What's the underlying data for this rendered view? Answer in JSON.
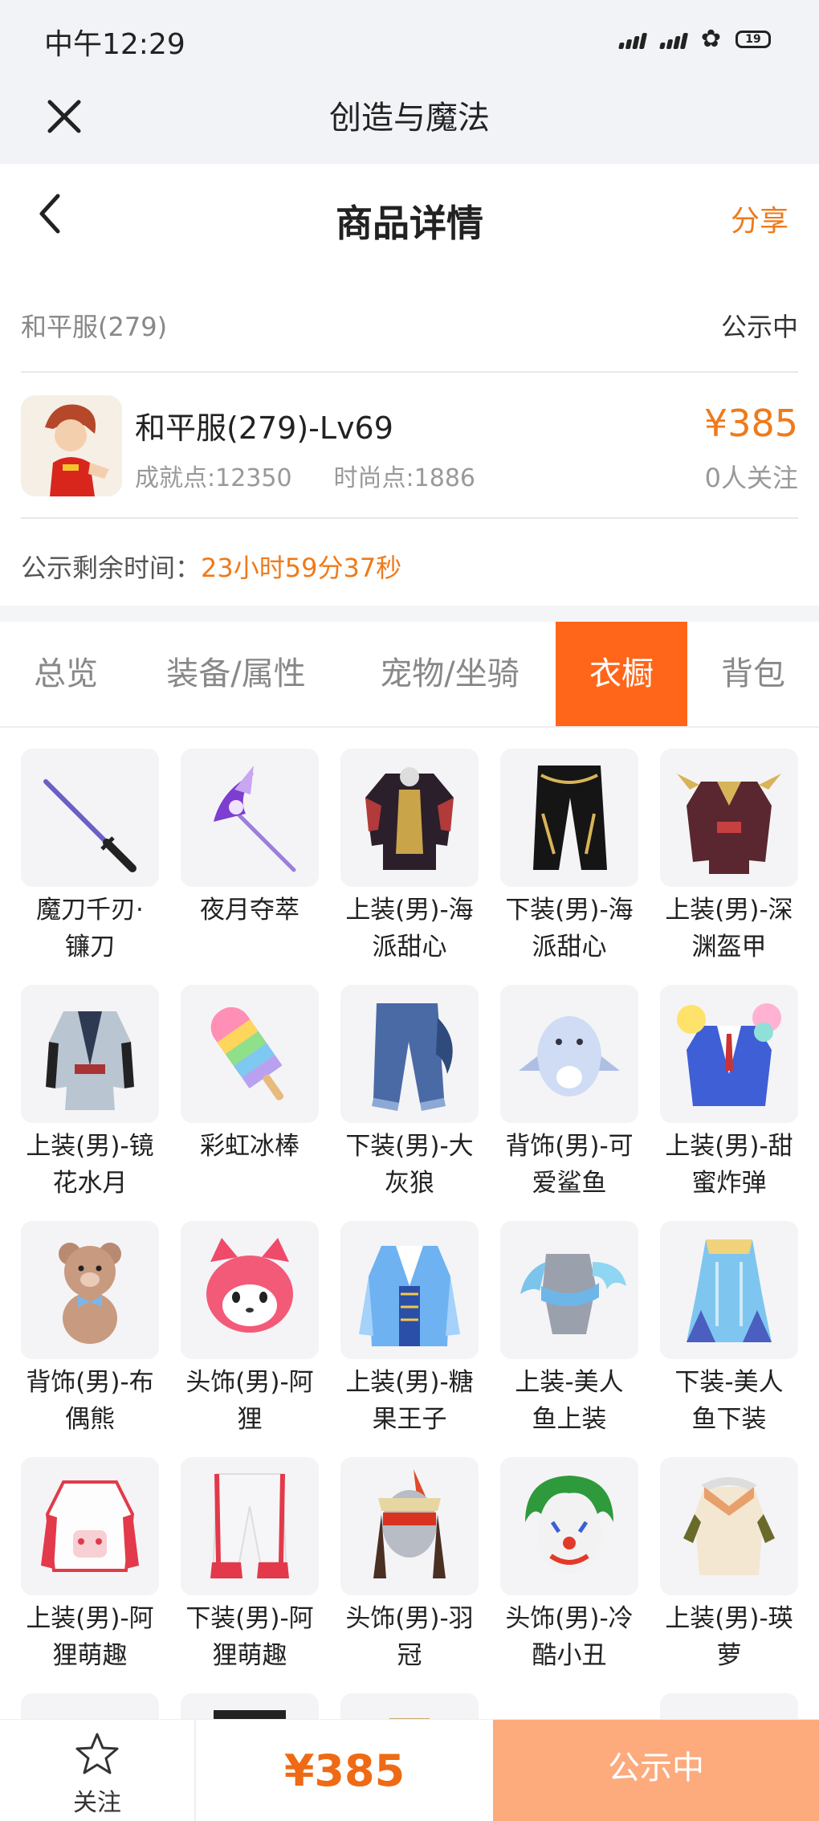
{
  "status_bar": {
    "time": "中午12:29",
    "battery": "19"
  },
  "app_header": {
    "title": "创造与魔法"
  },
  "nav": {
    "title": "商品详情",
    "share_label": "分享"
  },
  "listing": {
    "seller": "和平服(279)",
    "status": "公示中",
    "title": "和平服(279)-Lv69",
    "achievement": "成就点:12350",
    "fashion": "时尚点:1886",
    "price": "¥385",
    "followers": "0人关注",
    "timer_label": "公示剩余时间：",
    "timer_value": "23小时59分37秒"
  },
  "tabs": [
    {
      "label": "总览",
      "active": false
    },
    {
      "label": "装备/属性",
      "active": false
    },
    {
      "label": "宠物/坐骑",
      "active": false
    },
    {
      "label": "衣橱",
      "active": true
    },
    {
      "label": "背包",
      "active": false
    }
  ],
  "items": [
    {
      "line1": "魔刀千刃·",
      "line2": "镰刀",
      "icon": "katana-icon"
    },
    {
      "line1": "夜月夺萃",
      "line2": "",
      "icon": "staff-icon"
    },
    {
      "line1": "上装(男)-海",
      "line2": "派甜心",
      "icon": "jacket-icon"
    },
    {
      "line1": "下装(男)-海",
      "line2": "派甜心",
      "icon": "pants-icon"
    },
    {
      "line1": "上装(男)-深",
      "line2": "渊盔甲",
      "icon": "armor-icon"
    },
    {
      "line1": "上装(男)-镜",
      "line2": "花水月",
      "icon": "robe-icon"
    },
    {
      "line1": "彩虹冰棒",
      "line2": "",
      "icon": "popsicle-icon"
    },
    {
      "line1": "下装(男)-大",
      "line2": "灰狼",
      "icon": "wolf-pants-icon"
    },
    {
      "line1": "背饰(男)-可",
      "line2": "爱鲨鱼",
      "icon": "shark-icon"
    },
    {
      "line1": "上装(男)-甜",
      "line2": "蜜炸弹",
      "icon": "suit-icon"
    },
    {
      "line1": "背饰(男)-布",
      "line2": "偶熊",
      "icon": "teddy-bear-icon"
    },
    {
      "line1": "头饰(男)-阿",
      "line2": "狸",
      "icon": "fox-head-icon"
    },
    {
      "line1": "上装(男)-糖",
      "line2": "果王子",
      "icon": "prince-coat-icon"
    },
    {
      "line1": "上装-美人",
      "line2": "鱼上装",
      "icon": "mermaid-top-icon"
    },
    {
      "line1": "下装-美人",
      "line2": "鱼下装",
      "icon": "mermaid-skirt-icon"
    },
    {
      "line1": "上装(男)-阿",
      "line2": "狸萌趣",
      "icon": "hoodie-icon"
    },
    {
      "line1": "下装(男)-阿",
      "line2": "狸萌趣",
      "icon": "sweatpants-icon"
    },
    {
      "line1": "头饰(男)-羽",
      "line2": "冠",
      "icon": "feather-crown-icon"
    },
    {
      "line1": "头饰(男)-冷",
      "line2": "酷小丑",
      "icon": "clown-mask-icon"
    },
    {
      "line1": "上装(男)-瑛",
      "line2": "萝",
      "icon": "vest-icon"
    }
  ],
  "bottom_bar": {
    "follow_label": "关注",
    "price": "¥385",
    "action_label": "公示中"
  },
  "colors": {
    "accent": "#ff6619",
    "price": "#ef7a1a",
    "button_disabled": "#fdaa7d"
  }
}
